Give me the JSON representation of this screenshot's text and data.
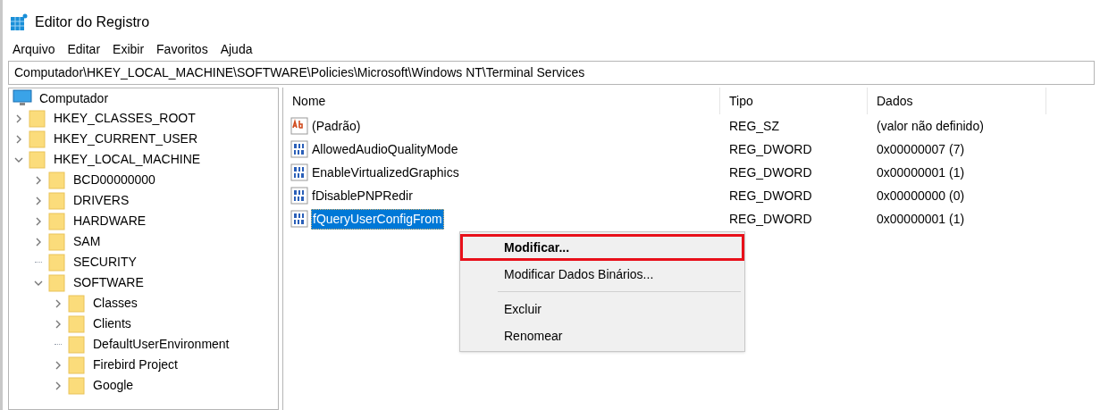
{
  "window": {
    "title": "Editor do Registro"
  },
  "menu_bar": [
    "Arquivo",
    "Editar",
    "Exibir",
    "Favoritos",
    "Ajuda"
  ],
  "address": "Computador\\HKEY_LOCAL_MACHINE\\SOFTWARE\\Policies\\Microsoft\\Windows NT\\Terminal Services",
  "tree": {
    "label": "Computador",
    "children": [
      {
        "label": "HKEY_CLASSES_ROOT",
        "expanded": false,
        "has_children": true
      },
      {
        "label": "HKEY_CURRENT_USER",
        "expanded": false,
        "has_children": true
      },
      {
        "label": "HKEY_LOCAL_MACHINE",
        "expanded": true,
        "has_children": true,
        "children": [
          {
            "label": "BCD00000000",
            "expanded": false,
            "has_children": true
          },
          {
            "label": "DRIVERS",
            "expanded": false,
            "has_children": true
          },
          {
            "label": "HARDWARE",
            "expanded": false,
            "has_children": true
          },
          {
            "label": "SAM",
            "expanded": false,
            "has_children": true
          },
          {
            "label": "SECURITY",
            "expanded": false,
            "has_children": false
          },
          {
            "label": "SOFTWARE",
            "expanded": true,
            "has_children": true,
            "children": [
              {
                "label": "Classes",
                "expanded": false,
                "has_children": true
              },
              {
                "label": "Clients",
                "expanded": false,
                "has_children": true
              },
              {
                "label": "DefaultUserEnvironment",
                "expanded": false,
                "has_children": false
              },
              {
                "label": "Firebird Project",
                "expanded": false,
                "has_children": true
              },
              {
                "label": "Google",
                "expanded": false,
                "has_children": true
              }
            ]
          }
        ]
      }
    ]
  },
  "table": {
    "columns": [
      "Nome",
      "Tipo",
      "Dados"
    ],
    "rows": [
      {
        "kind": "string",
        "name": "(Padrão)",
        "type": "REG_SZ",
        "data": "(valor não definido)",
        "selected": false
      },
      {
        "kind": "dword",
        "name": "AllowedAudioQualityMode",
        "type": "REG_DWORD",
        "data": "0x00000007 (7)",
        "selected": false
      },
      {
        "kind": "dword",
        "name": "EnableVirtualizedGraphics",
        "type": "REG_DWORD",
        "data": "0x00000001 (1)",
        "selected": false
      },
      {
        "kind": "dword",
        "name": "fDisablePNPRedir",
        "type": "REG_DWORD",
        "data": "0x00000000 (0)",
        "selected": false
      },
      {
        "kind": "dword",
        "name": "fQueryUserConfigFrom",
        "type": "REG_DWORD",
        "data": "0x00000001 (1)",
        "selected": true
      }
    ]
  },
  "context_menu": [
    {
      "kind": "item",
      "label": "Modificar...",
      "default": true,
      "highlighted": true
    },
    {
      "kind": "item",
      "label": "Modificar Dados Binários...",
      "default": false,
      "highlighted": false
    },
    {
      "kind": "separator"
    },
    {
      "kind": "item",
      "label": "Excluir",
      "default": false,
      "highlighted": false
    },
    {
      "kind": "item",
      "label": "Renomear",
      "default": false,
      "highlighted": false
    }
  ]
}
